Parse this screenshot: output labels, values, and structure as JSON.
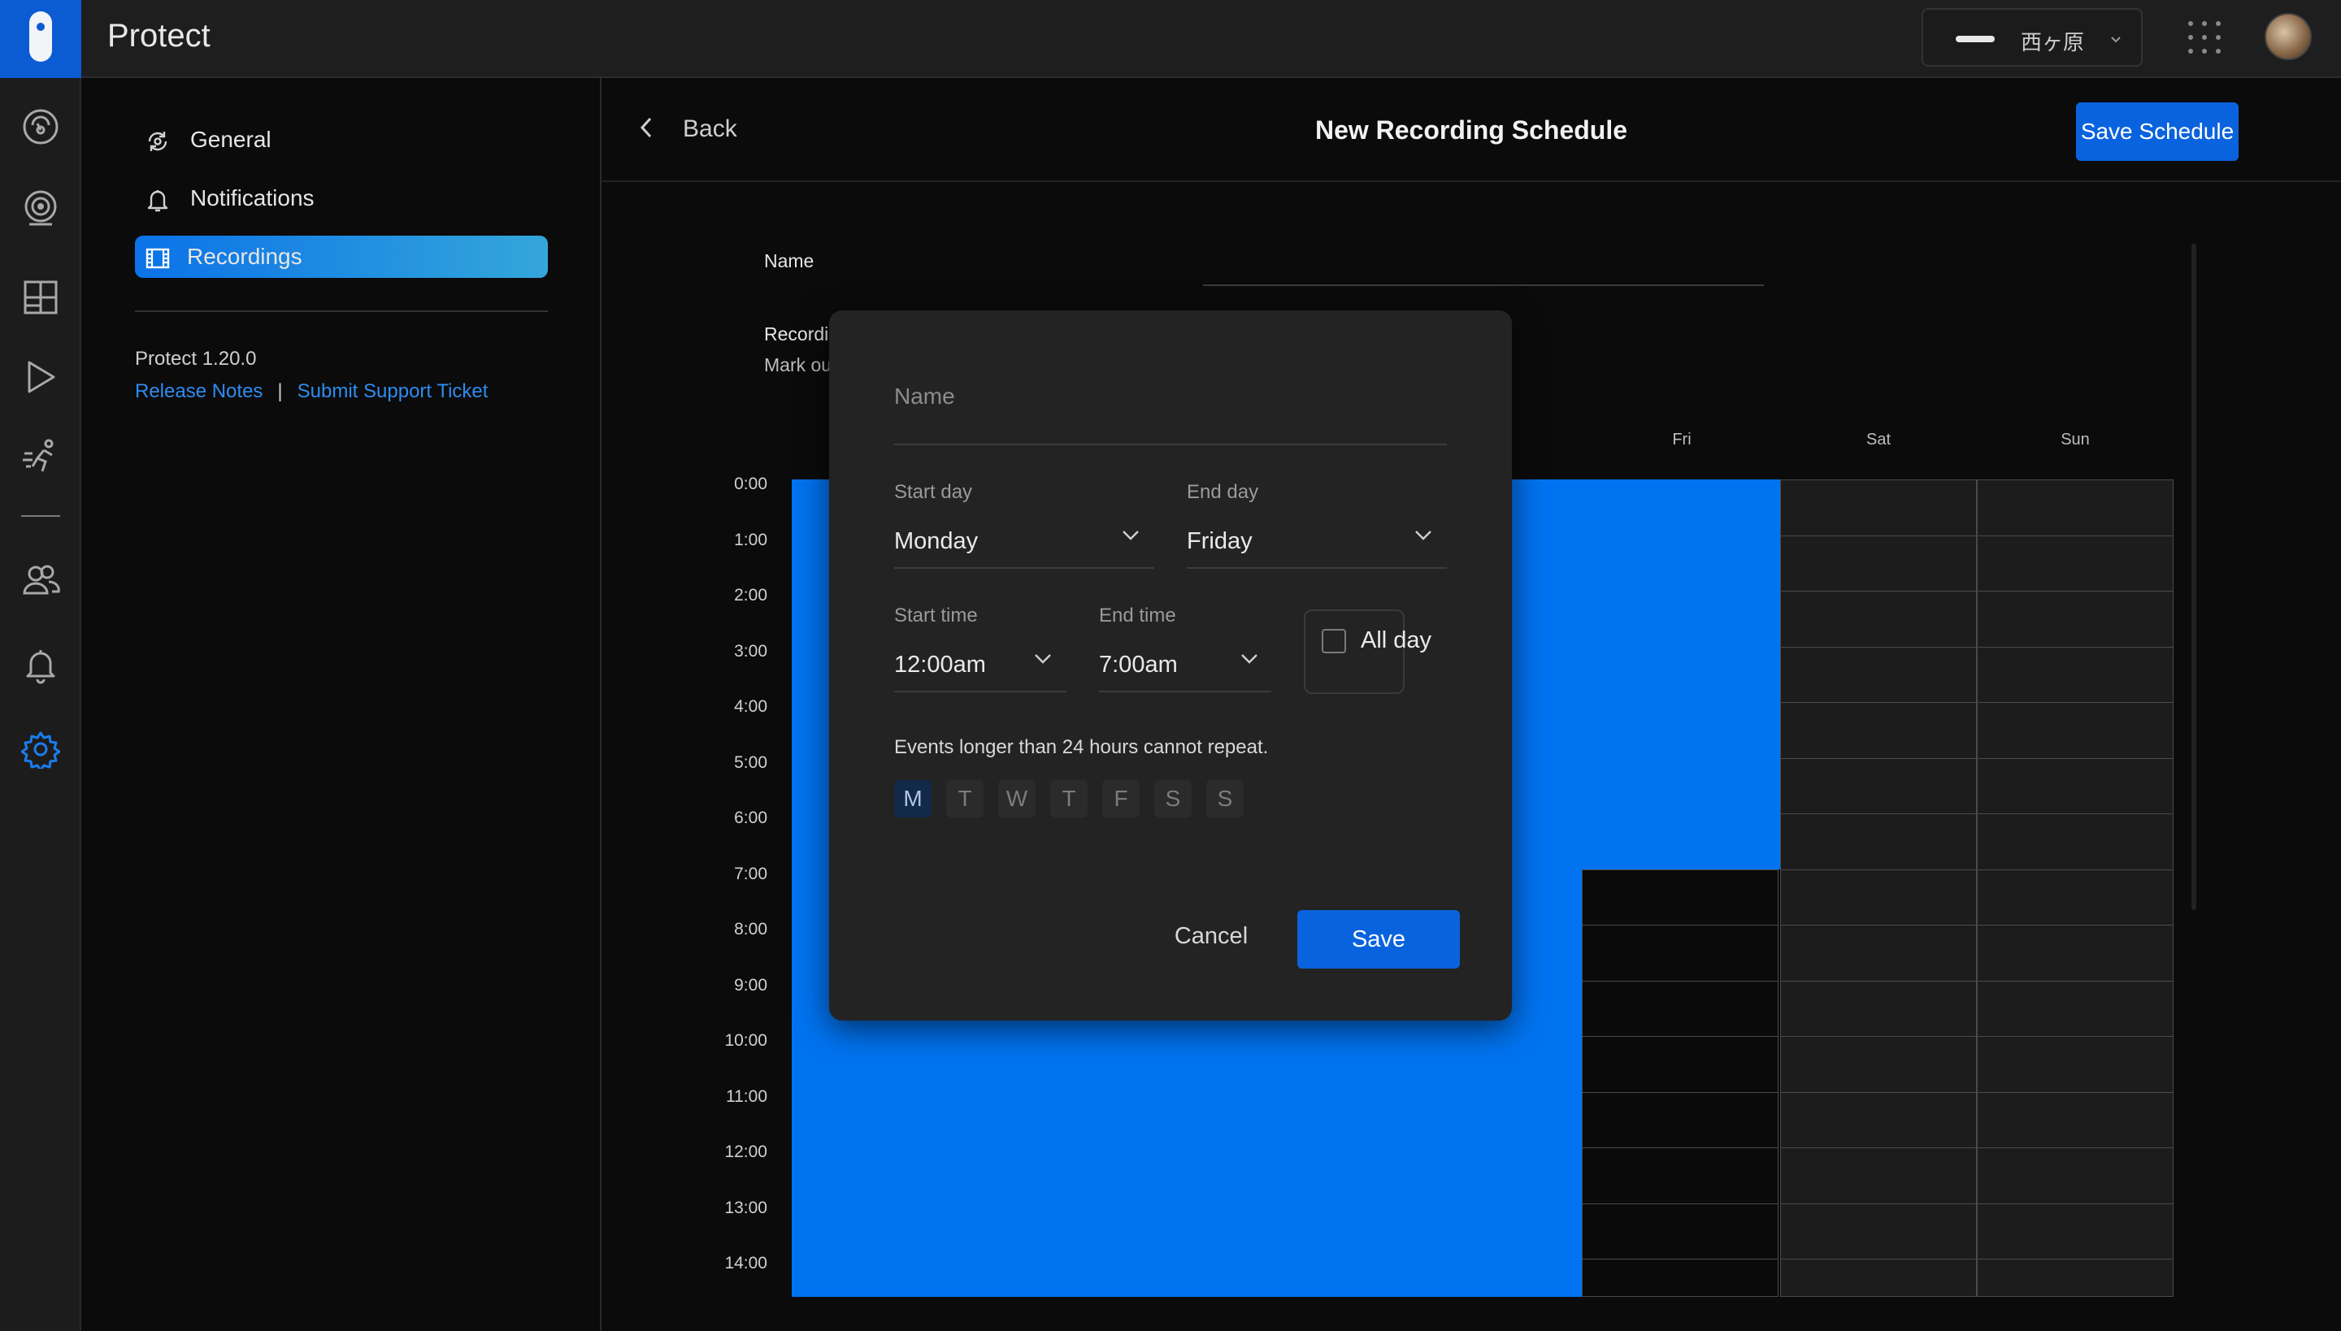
{
  "app": {
    "title": "Protect"
  },
  "console": {
    "name": "西ヶ原",
    "chevron": "chevron-down-icon"
  },
  "rail": {
    "items": [
      {
        "name": "dashboard-icon"
      },
      {
        "name": "devices-icon"
      },
      {
        "name": "liveview-icon"
      },
      {
        "name": "timelines-icon"
      },
      {
        "name": "detections-icon"
      },
      {
        "name": "users-icon"
      },
      {
        "name": "alarms-icon"
      },
      {
        "name": "settings-icon",
        "active": true
      }
    ]
  },
  "settings_nav": {
    "items": [
      {
        "label": "General",
        "icon": "general-settings-icon"
      },
      {
        "label": "Notifications",
        "icon": "bell-icon"
      },
      {
        "label": "Recordings",
        "icon": "film-icon",
        "active": true
      }
    ],
    "version": "Protect 1.20.0",
    "release_notes": "Release Notes",
    "separator": "|",
    "support": "Submit Support Ticket"
  },
  "header": {
    "back": "Back",
    "title": "New Recording Schedule",
    "save": "Save Schedule"
  },
  "form": {
    "name_label": "Name",
    "recording_label": "Recordi",
    "recording_desc": "Mark ou"
  },
  "schedule": {
    "visible_days": [
      "Fri",
      "Sat",
      "Sun"
    ],
    "hours": [
      "0:00",
      "1:00",
      "2:00",
      "3:00",
      "4:00",
      "5:00",
      "6:00",
      "7:00",
      "8:00",
      "9:00",
      "10:00",
      "11:00",
      "12:00",
      "13:00",
      "14:00"
    ],
    "selected_color": "#0073f0"
  },
  "modal": {
    "name_placeholder": "Name",
    "start_day_label": "Start day",
    "start_day": "Monday",
    "end_day_label": "End day",
    "end_day": "Friday",
    "start_time_label": "Start time",
    "start_time": "12:00am",
    "end_time_label": "End time",
    "end_time": "7:00am",
    "all_day": "All day",
    "all_day_checked": false,
    "note": "Events longer than 24 hours cannot repeat.",
    "repeat_days": [
      {
        "label": "M",
        "active": true
      },
      {
        "label": "T",
        "active": false
      },
      {
        "label": "W",
        "active": false
      },
      {
        "label": "T",
        "active": false
      },
      {
        "label": "F",
        "active": false
      },
      {
        "label": "S",
        "active": false
      },
      {
        "label": "S",
        "active": false
      }
    ],
    "cancel": "Cancel",
    "save": "Save"
  }
}
